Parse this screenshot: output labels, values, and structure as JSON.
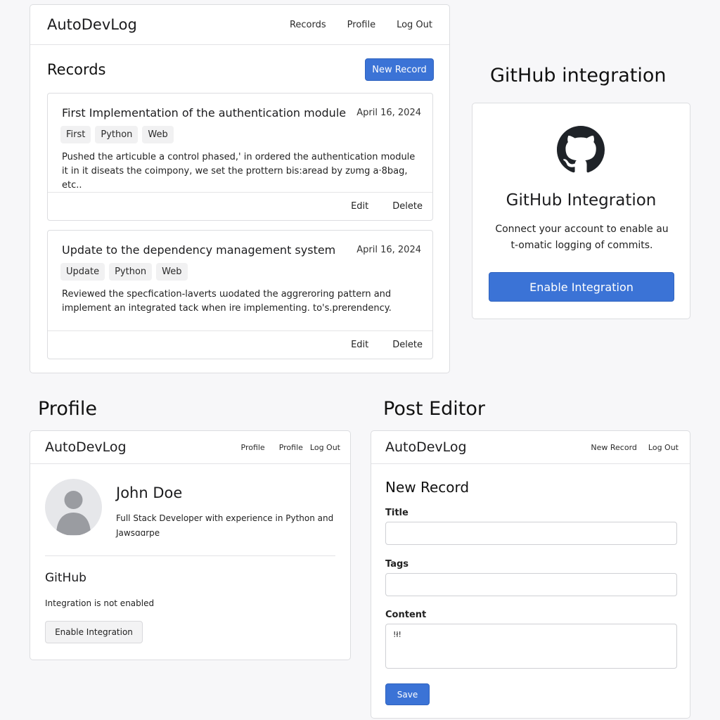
{
  "records_panel": {
    "brand": "AutoDevLog",
    "nav": [
      "Records",
      "Profile",
      "Log Out"
    ],
    "title": "Records",
    "new_record_label": "New Record",
    "records": [
      {
        "title": "First Implementation of the authentication module",
        "date": "April 16, 2024",
        "tags": [
          "First",
          "Python",
          "Web"
        ],
        "body": "Pushed the articuble a control phased,' in ordered the authentication module  it in it diseats the coimpony, we set the prottern bis:aread by zυmg a·8bag, etc..",
        "edit_label": "Edit",
        "delete_label": "Delete"
      },
      {
        "title": "Update to the dependency management system",
        "date": "April 16, 2024",
        "tags": [
          "Update",
          "Python",
          "Web"
        ],
        "body": "Reviewed the specfication-laverts ɯodated the aggreroring pattern and implement an integrated tack when ire implementing. to's.prerendency.",
        "edit_label": "Edit",
        "delete_label": "Delete"
      }
    ]
  },
  "github_section": {
    "heading": "GitHub integration",
    "icon": "github-icon",
    "card_title": "GitHub Integration",
    "description": "Connect your account to enable aut-omatic logging of commits.",
    "button_label": "Enable Integration"
  },
  "profile_section": {
    "heading": "Profile",
    "brand": "AutoDevLog",
    "nav": [
      "Profile",
      "Profile",
      "Log Out"
    ],
    "name": "John Doe",
    "bio": "Full Stack Developer with experience in Python and Jawsɑɑrpe",
    "github_title": "GitHub",
    "github_status": "Integration is not enabled",
    "button_label": "Enable Integration"
  },
  "editor_section": {
    "heading": "Post Editor",
    "brand": "AutoDevLog",
    "nav": [
      "New Record",
      "Log Out"
    ],
    "form_title": "New Record",
    "title_label": "Title",
    "tags_label": "Tags",
    "content_label": "Content",
    "content_value": "!ł!",
    "save_label": "Save"
  }
}
